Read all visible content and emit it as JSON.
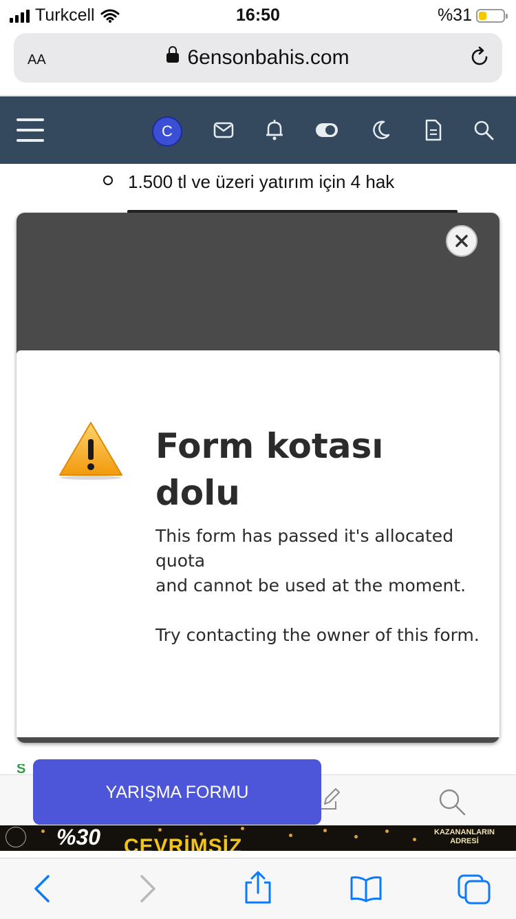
{
  "status_bar": {
    "carrier": "Turkcell",
    "time": "16:50",
    "battery_label": "%31",
    "battery_level": 0.31
  },
  "url_bar": {
    "text_size_label": "AA",
    "url": "6ensonbahis.com"
  },
  "site_nav": {
    "avatar_letter": "C",
    "icons": [
      "menu-icon",
      "mail-icon",
      "bell-icon",
      "toggle-icon",
      "moon-icon",
      "document-icon",
      "search-icon"
    ]
  },
  "content": {
    "bullet_text": "1.500 tl ve üzeri yatırım için 4 hak"
  },
  "modal": {
    "title": "Form kotası dolu",
    "message": "This form has passed it's allocated quota\nand cannot be used at the moment.\n\nTry contacting the owner of this form."
  },
  "contest_button": {
    "label": "YARIŞMA FORMU"
  },
  "banner": {
    "percent": "%30",
    "partial_text": "ÇEVRİMSİZ",
    "right_text": "KAZANANLARIN ADRESİ"
  },
  "safari_toolbar": {
    "icons": [
      "back-icon",
      "forward-icon",
      "share-icon",
      "bookmarks-icon",
      "tabs-icon"
    ]
  },
  "colors": {
    "nav_bg": "#34495e",
    "contest_button": "#4d55d8",
    "safari_blue": "#0a7aff",
    "modal_overlay": "#4a4a4a"
  }
}
